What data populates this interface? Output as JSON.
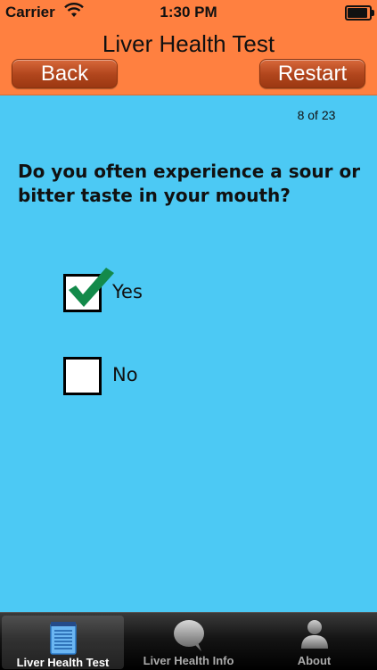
{
  "status_bar": {
    "carrier": "Carrier",
    "time": "1:30 PM"
  },
  "nav": {
    "title": "Liver Health Test",
    "back_label": "Back",
    "restart_label": "Restart"
  },
  "progress_text": "8 of 23",
  "question": "Do you often experience a sour or bitter taste in your mouth?",
  "options": [
    {
      "label": "Yes",
      "checked": true
    },
    {
      "label": "No",
      "checked": false
    }
  ],
  "tabs": [
    {
      "label": "Liver Health Test",
      "icon": "notepad-icon",
      "active": true
    },
    {
      "label": "Liver Health Info",
      "icon": "speech-bubble-icon",
      "active": false
    },
    {
      "label": "About",
      "icon": "person-icon",
      "active": false
    }
  ],
  "colors": {
    "header": "#ff8040",
    "background": "#4cc9f4",
    "check": "#138a4a"
  }
}
